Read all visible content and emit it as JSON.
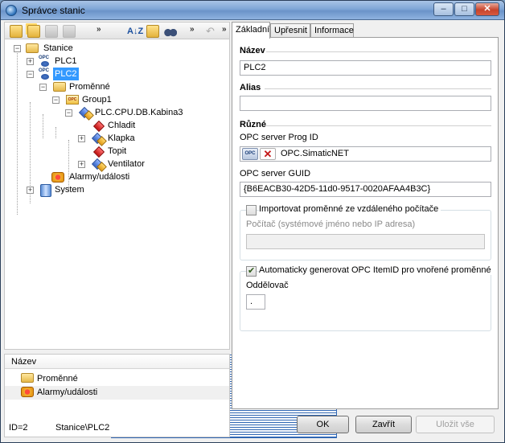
{
  "window": {
    "title": "Správce stanic"
  },
  "titlebar": {
    "min": "–",
    "max": "□",
    "close": "✕"
  },
  "left_toolbar": {
    "chevron1": "»",
    "chevron2": "»",
    "chevron3": "»",
    "undo": "↶",
    "sort": "A↓Z"
  },
  "tree": {
    "root": "Stanice",
    "plc1": "PLC1",
    "plc2": "PLC2",
    "promenne": "Proměnné",
    "group1": "Group1",
    "db": "PLC.CPU.DB.Kabina3",
    "chladit": "Chladit",
    "klapka": "Klapka",
    "topit": "Topit",
    "ventilator": "Ventilator",
    "alarmy": "Alarmy/události",
    "system": "System"
  },
  "list": {
    "header": "Název",
    "rows": [
      "Proměnné",
      "Alarmy/události"
    ]
  },
  "status": {
    "id": "ID=2",
    "path": "Stanice\\PLC2"
  },
  "tabs": [
    "Základní",
    "Upřesnit",
    "Informace"
  ],
  "form": {
    "nazev_section": "Název",
    "nazev_value": "PLC2",
    "alias_section": "Alias",
    "alias_value": "",
    "ruzne_section": "Různé",
    "prog_id_label": "OPC server Prog ID",
    "prog_id_value": "OPC.SimaticNET",
    "guid_label": "OPC server GUID",
    "guid_value": "{B6EACB30-42D5-11d0-9517-0020AFAA4B3C}",
    "import_label": "Importovat proměnné ze vzdáleného počítače",
    "computer_label": "Počítač (systémové jméno nebo IP adresa)",
    "computer_value": "",
    "auto_label": "Automaticky generovat OPC ItemID pro vnořené proměnné",
    "separator_label": "Oddělovač",
    "separator_value": ".",
    "opc_btn": "OPC"
  },
  "buttons": {
    "ok": "OK",
    "close": "Zavřít",
    "save_all": "Uložit vše"
  },
  "colors": {
    "selection": "#3399ff",
    "title_gradient": "#7ea5d6"
  }
}
